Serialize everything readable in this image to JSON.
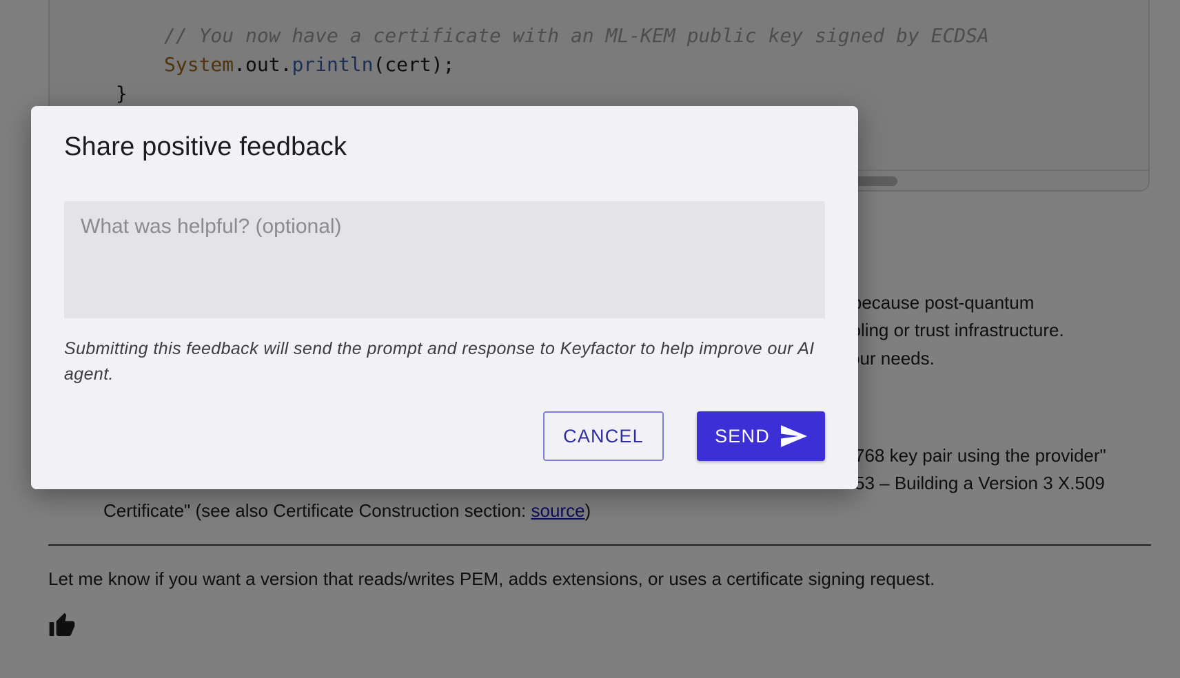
{
  "code": {
    "comment": "// You now have a certificate with an ML-KEM public key signed by ECDSA",
    "print_class": "System",
    "print_dot1": ".",
    "print_field": "out",
    "print_dot2": ".",
    "print_method": "println",
    "print_args": "(cert);",
    "closing_brace": "}"
  },
  "background_text": {
    "line1": ") because post-quantum",
    "line2": "ooling or trust infrastructure.",
    "line3": " your needs.",
    "line4": "768 key pair using the provider\"",
    "line5": "53 – Building a Version 3 X.509",
    "line6_prefix": "Certificate\" (see also Certificate Construction section: ",
    "line6_link": "source",
    "line6_suffix": ")",
    "closing": "Let me know if you want a version that reads/writes PEM, adds extensions, or uses a certificate signing request."
  },
  "dialog": {
    "title": "Share positive feedback",
    "input_placeholder": "What was helpful? (optional)",
    "input_value": "",
    "disclaimer": "Submitting this feedback will send the prompt and response to Keyfactor to help improve our AI agent.",
    "cancel_label": "CANCEL",
    "send_label": "SEND"
  },
  "colors": {
    "accent": "#3c2fd6",
    "dialog_bg": "#f1f1f6",
    "scrim": "rgba(0,0,0,0.5)"
  },
  "icons": {
    "send": "send-icon",
    "thumbs_up": "thumbs-up-icon"
  }
}
